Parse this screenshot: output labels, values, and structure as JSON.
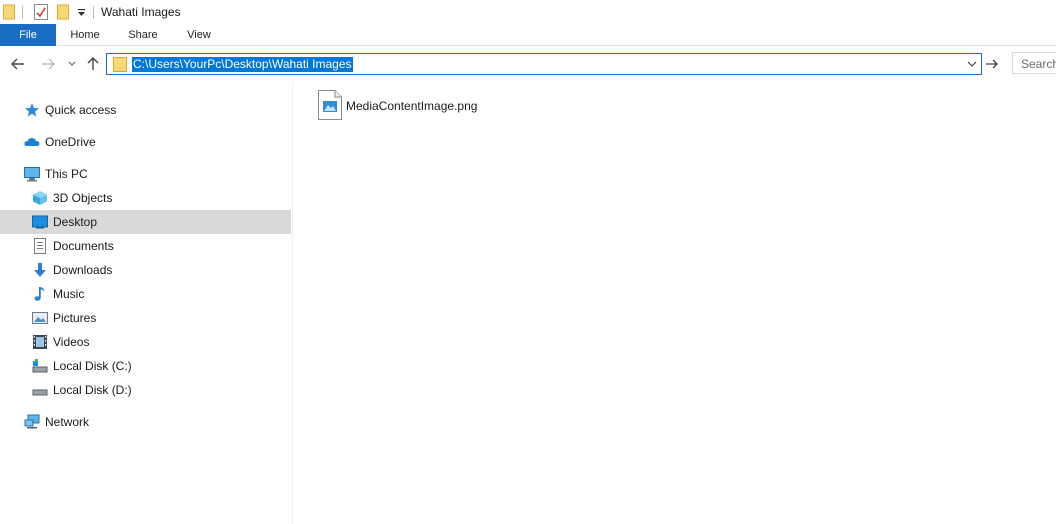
{
  "window": {
    "title": "Wahati Images"
  },
  "ribbon": {
    "tabs": [
      "File",
      "Home",
      "Share",
      "View"
    ]
  },
  "address": {
    "path": "C:\\Users\\YourPc\\Desktop\\Wahati Images"
  },
  "search": {
    "placeholder": "Search"
  },
  "sidebar": {
    "items": [
      {
        "label": "Quick access",
        "icon": "star-icon"
      },
      {
        "label": "OneDrive",
        "icon": "cloud-icon"
      },
      {
        "label": "This PC",
        "icon": "computer-icon"
      },
      {
        "label": "3D Objects",
        "icon": "cube-icon"
      },
      {
        "label": "Desktop",
        "icon": "desktop-icon",
        "selected": true
      },
      {
        "label": "Documents",
        "icon": "document-icon"
      },
      {
        "label": "Downloads",
        "icon": "download-icon"
      },
      {
        "label": "Music",
        "icon": "music-icon"
      },
      {
        "label": "Pictures",
        "icon": "pictures-icon"
      },
      {
        "label": "Videos",
        "icon": "video-icon"
      },
      {
        "label": "Local Disk (C:)",
        "icon": "drive-icon"
      },
      {
        "label": "Local Disk (D:)",
        "icon": "drive-icon"
      },
      {
        "label": "Network",
        "icon": "network-icon"
      }
    ]
  },
  "files": [
    {
      "name": "MediaContentImage.png",
      "icon": "image-file-icon"
    }
  ],
  "colors": {
    "accent": "#1a6fc4",
    "selection": "#0078d7",
    "selected_row": "#d9d9d9",
    "folder": "#f8d775"
  }
}
